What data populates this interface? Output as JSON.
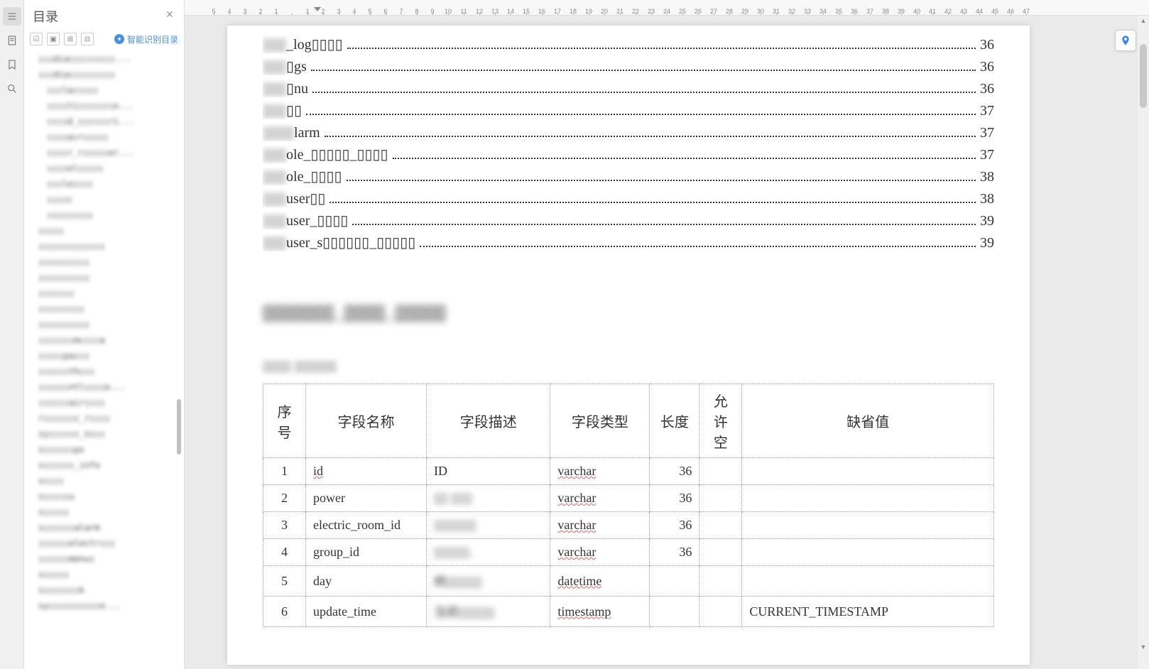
{
  "sidebar": {
    "title": "目录",
    "smart_label": "智能识别目录",
    "items": [
      "▯▯▯dia▯▯▯▯▯▯▯▯▯...",
      "▯▯▯dia▯▯▯▯▯▯▯▯▯",
      "▯▯▯la▯▯▯▯▯",
      "▯▯▯▯ti▯▯▯▯▯▯▯o...",
      "▯▯▯▯d_▯▯▯▯▯▯ri...",
      "▯▯▯▯a▯r▯▯▯▯▯",
      "▯▯▯▯r_r▯▯▯▯▯er...",
      "▯▯▯▯ol▯▯▯▯▯",
      "▯▯▯le▯▯▯▯",
      "▯▯▯▯c",
      "▯▯▯▯▯▯▯▯▯",
      "▯▯▯▯▯",
      "▯▯▯▯▯▯▯▯▯▯▯▯▯",
      "▯▯▯▯▯▯▯▯▯▯",
      "▯▯▯▯▯▯▯▯▯▯",
      "▯▯▯▯▯▯▯",
      "▯▯▯▯▯▯▯▯▯",
      "▯▯▯▯▯▯▯▯▯▯",
      "▯▯▯▯▯▯▯m▯▯▯▯a",
      "▯▯▯▯▯pa▯▯▯",
      "▯▯▯▯▯▯th▯▯▯",
      "▯▯▯▯▯▯ntl▯▯▯▯e...",
      "▯▯▯▯▯▯air▯▯▯▯",
      "r▯▯▯▯▯▯c_r▯▯▯▯",
      "sy▯▯▯▯▯c_n▯▯▯",
      "s▯▯▯▯▯▯ps",
      "s▯▯▯▯▯▯_info",
      "s▯▯▯▯",
      "s▯▯▯▯▯u",
      "s▯▯▯▯▯",
      "s▯▯▯▯▯▯alarm",
      "▯▯▯▯▯▯electr▯▯▯",
      "▯▯▯▯▯▯menu▯",
      "s▯▯▯▯▯",
      "s▯▯▯▯▯▯▯k",
      "sy▯▯▯▯▯▯▯▯▯▯e..."
    ]
  },
  "ruler": [
    "5",
    "4",
    "3",
    "2",
    "1",
    "",
    "1",
    "2",
    "3",
    "4",
    "5",
    "6",
    "7",
    "8",
    "9",
    "10",
    "11",
    "12",
    "13",
    "14",
    "15",
    "16",
    "17",
    "18",
    "19",
    "20",
    "21",
    "22",
    "23",
    "24",
    "25",
    "26",
    "27",
    "28",
    "29",
    "30",
    "31",
    "32",
    "33",
    "34",
    "35",
    "36",
    "37",
    "38",
    "39",
    "40",
    "41",
    "42",
    "43",
    "44",
    "45",
    "46",
    "47"
  ],
  "toc_rows": [
    {
      "prefix": "▯▯▯",
      "label": "_log▯▯▯▯",
      "page": "36"
    },
    {
      "prefix": "▯▯▯",
      "label": "▯gs",
      "page": "36"
    },
    {
      "prefix": "▯▯▯",
      "label": "▯nu",
      "page": "36"
    },
    {
      "prefix": "▯▯▯",
      "label": "▯▯",
      "page": "37"
    },
    {
      "prefix": "▯▯▯▯",
      "label": "larm",
      "page": "37"
    },
    {
      "prefix": "▯▯▯",
      "label": "ole_▯▯▯▯▯_▯▯▯▯",
      "page": "37"
    },
    {
      "prefix": "▯▯▯",
      "label": "ole_▯▯▯▯",
      "page": "38"
    },
    {
      "prefix": "▯▯▯",
      "label": "user▯▯",
      "page": "38"
    },
    {
      "prefix": "▯▯▯",
      "label": "user_▯▯▯▯",
      "page": "39"
    },
    {
      "prefix": "▯▯▯",
      "label": "user_s▯▯▯▯▯▯_▯▯▯▯▯",
      "page": "39"
    }
  ],
  "section": {
    "title": "▯▯▯▯▯▯▯_▯▯▯▯_▯▯▯▯▯",
    "subtitle": "▯▯▯▯  ▯▯▯▯▯▯"
  },
  "table": {
    "headers": [
      "序号",
      "字段名称",
      "字段描述",
      "字段类型",
      "长度",
      "允许空",
      "缺省值"
    ],
    "rows": [
      {
        "seq": "1",
        "name": "id",
        "desc": "ID",
        "type": "varchar",
        "len": "36",
        "allow": "",
        "def": ""
      },
      {
        "seq": "2",
        "name": "power",
        "desc": "▯▯ ▯▯▯",
        "type": "varchar",
        "len": "36",
        "allow": "",
        "def": ""
      },
      {
        "seq": "3",
        "name": "electric_room_id",
        "desc": "▯▯▯▯▯▯",
        "type": "varchar",
        "len": "36",
        "allow": "",
        "def": ""
      },
      {
        "seq": "4",
        "name": "group_id",
        "desc": "▯▯▯▯▯.",
        "type": "varchar",
        "len": "36",
        "allow": "",
        "def": ""
      },
      {
        "seq": "5",
        "name": "day",
        "desc": "统▯▯▯▯▯",
        "type": "datetime",
        "len": "",
        "allow": "",
        "def": ""
      },
      {
        "seq": "6",
        "name": "update_time",
        "desc": "当前▯▯▯▯▯",
        "type": "timestamp",
        "len": "",
        "allow": "",
        "def": "CURRENT_TIMESTAMP"
      }
    ]
  }
}
